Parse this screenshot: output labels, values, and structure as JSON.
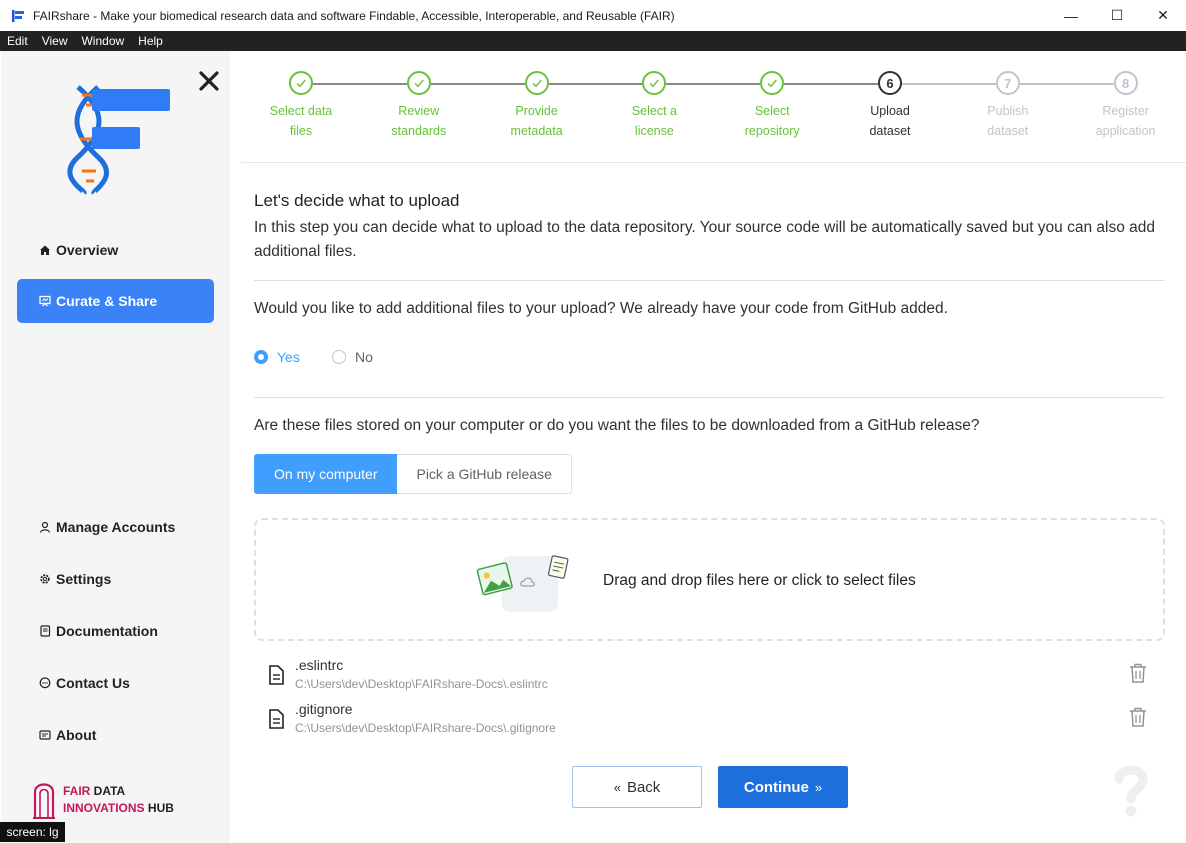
{
  "window": {
    "title": "FAIRshare - Make your biomedical research data and software Findable, Accessible, Interoperable, and Reusable (FAIR)",
    "controls": [
      "—",
      "☐",
      "✕"
    ]
  },
  "menubar": {
    "items": [
      "Edit",
      "View",
      "Window",
      "Help"
    ]
  },
  "sidebar": {
    "close_icon": "close-icon",
    "top_items": [
      {
        "label": "Overview",
        "icon": "home-icon"
      },
      {
        "label": "Curate & Share",
        "icon": "curate-icon",
        "active": true
      }
    ],
    "bottom_items": [
      {
        "label": "Manage Accounts",
        "icon": "user-icon"
      },
      {
        "label": "Settings",
        "icon": "gear-icon"
      },
      {
        "label": "Documentation",
        "icon": "book-icon"
      },
      {
        "label": "Contact Us",
        "icon": "chat-icon"
      },
      {
        "label": "About",
        "icon": "info-icon"
      }
    ],
    "brand": {
      "line1_a": "FAIR",
      "line1_b": " DATA",
      "line2_a": "INNOVATIONS",
      "line2_b": " HUB"
    },
    "screen_badge": "screen: lg"
  },
  "stepper": {
    "colors": {
      "done": "#67c23a",
      "current": "#303133",
      "wait": "#c0c4cc"
    },
    "steps": [
      {
        "line1": "Select data",
        "line2": "files",
        "status": "done"
      },
      {
        "line1": "Review",
        "line2": "standards",
        "status": "done"
      },
      {
        "line1": "Provide",
        "line2": "metadata",
        "status": "done"
      },
      {
        "line1": "Select a",
        "line2": "license",
        "status": "done"
      },
      {
        "line1": "Select",
        "line2": "repository",
        "status": "done"
      },
      {
        "line1": "Upload",
        "line2": "dataset",
        "status": "current",
        "number": "6"
      },
      {
        "line1": "Publish",
        "line2": "dataset",
        "status": "wait",
        "number": "7"
      },
      {
        "line1": "Register",
        "line2": "application",
        "status": "wait",
        "number": "8"
      }
    ]
  },
  "content": {
    "heading": "Let's decide what to upload",
    "description": "In this step you can decide what to upload to the data repository. Your source code will be automatically saved but you can also add additional files.",
    "question1": "Would you like to add additional files to your upload? We already have your code from GitHub added.",
    "radio_yes": "Yes",
    "radio_no": "No",
    "selected": "Yes",
    "question2": "Are these files stored on your computer or do you want the files to be downloaded from a GitHub release?",
    "seg_on": "On my computer",
    "seg_off": "Pick a GitHub release",
    "dropzone_text": "Drag and drop files here or click to select files",
    "files": [
      {
        "name": ".eslintrc",
        "path": "C:\\Users\\dev\\Desktop\\FAIRshare-Docs\\.eslintrc"
      },
      {
        "name": ".gitignore",
        "path": "C:\\Users\\dev\\Desktop\\FAIRshare-Docs\\.gitignore"
      }
    ],
    "back_label": "Back",
    "continue_label": "Continue"
  },
  "colors": {
    "accent": "#409eff",
    "nav_active": "#3b82f6",
    "continue": "#1d6fdc",
    "brand_pink": "#c2185b"
  }
}
